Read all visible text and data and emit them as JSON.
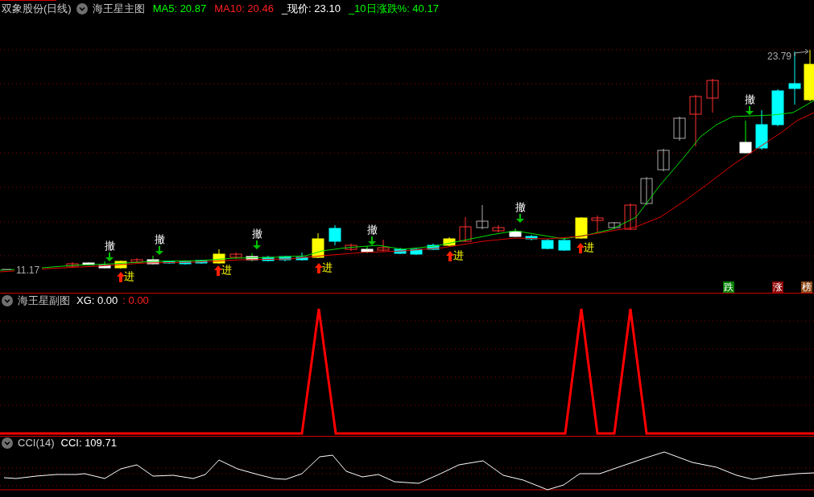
{
  "main_panel": {
    "stock_title": "双象股份(日线)",
    "indicator_name": "海王星主图",
    "readings": [
      {
        "label": "MA5: 20.87",
        "color": "#00ff00"
      },
      {
        "label": "MA10: 20.46",
        "color": "#ff2020"
      },
      {
        "label": "_现价: 23.10",
        "color": "#ffffff"
      },
      {
        "label": "_10日涨跌%: 40.17",
        "color": "#00ff00"
      }
    ],
    "high_price": "23.79",
    "low_price": "11.17",
    "signals": [
      {
        "kind": "exit",
        "label": "撤"
      },
      {
        "kind": "entry",
        "label": "进"
      },
      {
        "kind": "exit",
        "label": "撤"
      },
      {
        "kind": "entry",
        "label": "进"
      },
      {
        "kind": "exit",
        "label": "撤"
      },
      {
        "kind": "entry",
        "label": "进"
      },
      {
        "kind": "exit",
        "label": "撤"
      },
      {
        "kind": "entry",
        "label": "进"
      },
      {
        "kind": "exit",
        "label": "撤"
      },
      {
        "kind": "entry",
        "label": "进"
      },
      {
        "kind": "exit",
        "label": "撤"
      }
    ],
    "badges": [
      {
        "label": "跌",
        "color": "#007f00"
      },
      {
        "label": "涨",
        "color": "#8b0000"
      },
      {
        "label": "榜",
        "color": "#8b4513"
      }
    ]
  },
  "sub_panel": {
    "indicator_name": "海王星副图",
    "readings": [
      {
        "label": "XG: 0.00",
        "color": "#ffffff"
      },
      {
        "label": ": 0.00",
        "color": "#ff2020"
      }
    ]
  },
  "cci_panel": {
    "indicator_name": "CCI(14)",
    "readings": [
      {
        "label": "CCI: 109.71",
        "color": "#ffffff"
      }
    ]
  }
}
